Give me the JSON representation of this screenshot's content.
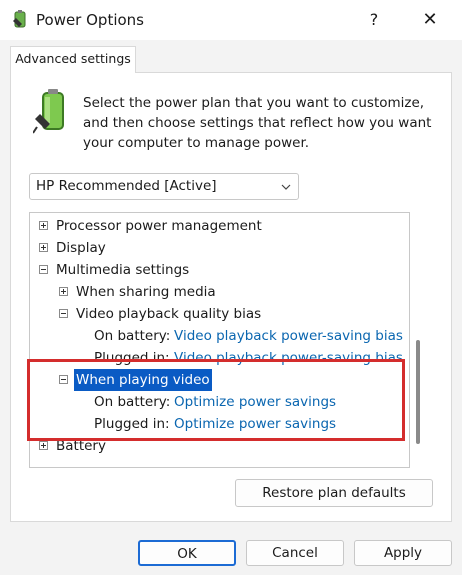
{
  "window": {
    "title": "Power Options",
    "help_glyph": "?",
    "close_glyph": "✕",
    "icon": "power-options-icon"
  },
  "tab": {
    "label": "Advanced settings"
  },
  "description": "Select the power plan that you want to customize, and then choose settings that reflect how you want your computer to manage power.",
  "plan_select": {
    "value": "HP Recommended [Active]"
  },
  "tree": {
    "processor": "Processor power management",
    "display": "Display",
    "multimedia": "Multimedia settings",
    "sharing_media": "When sharing media",
    "video_quality": "Video playback quality bias",
    "vq_on_battery_label": "On battery:",
    "vq_on_battery_value": "Video playback power-saving bias",
    "vq_plugged_label": "Plugged in:",
    "vq_plugged_value": "Video playback power-saving bias",
    "playing_video": "When playing video",
    "pv_on_battery_label": "On battery:",
    "pv_on_battery_value": "Optimize power savings",
    "pv_plugged_label": "Plugged in:",
    "pv_plugged_value": "Optimize power savings",
    "battery": "Battery"
  },
  "buttons": {
    "restore": "Restore plan defaults",
    "ok": "OK",
    "cancel": "Cancel",
    "apply": "Apply"
  },
  "colors": {
    "link": "#0a66b0",
    "selection": "#0a5bc4",
    "annotation": "#d42d2d"
  }
}
